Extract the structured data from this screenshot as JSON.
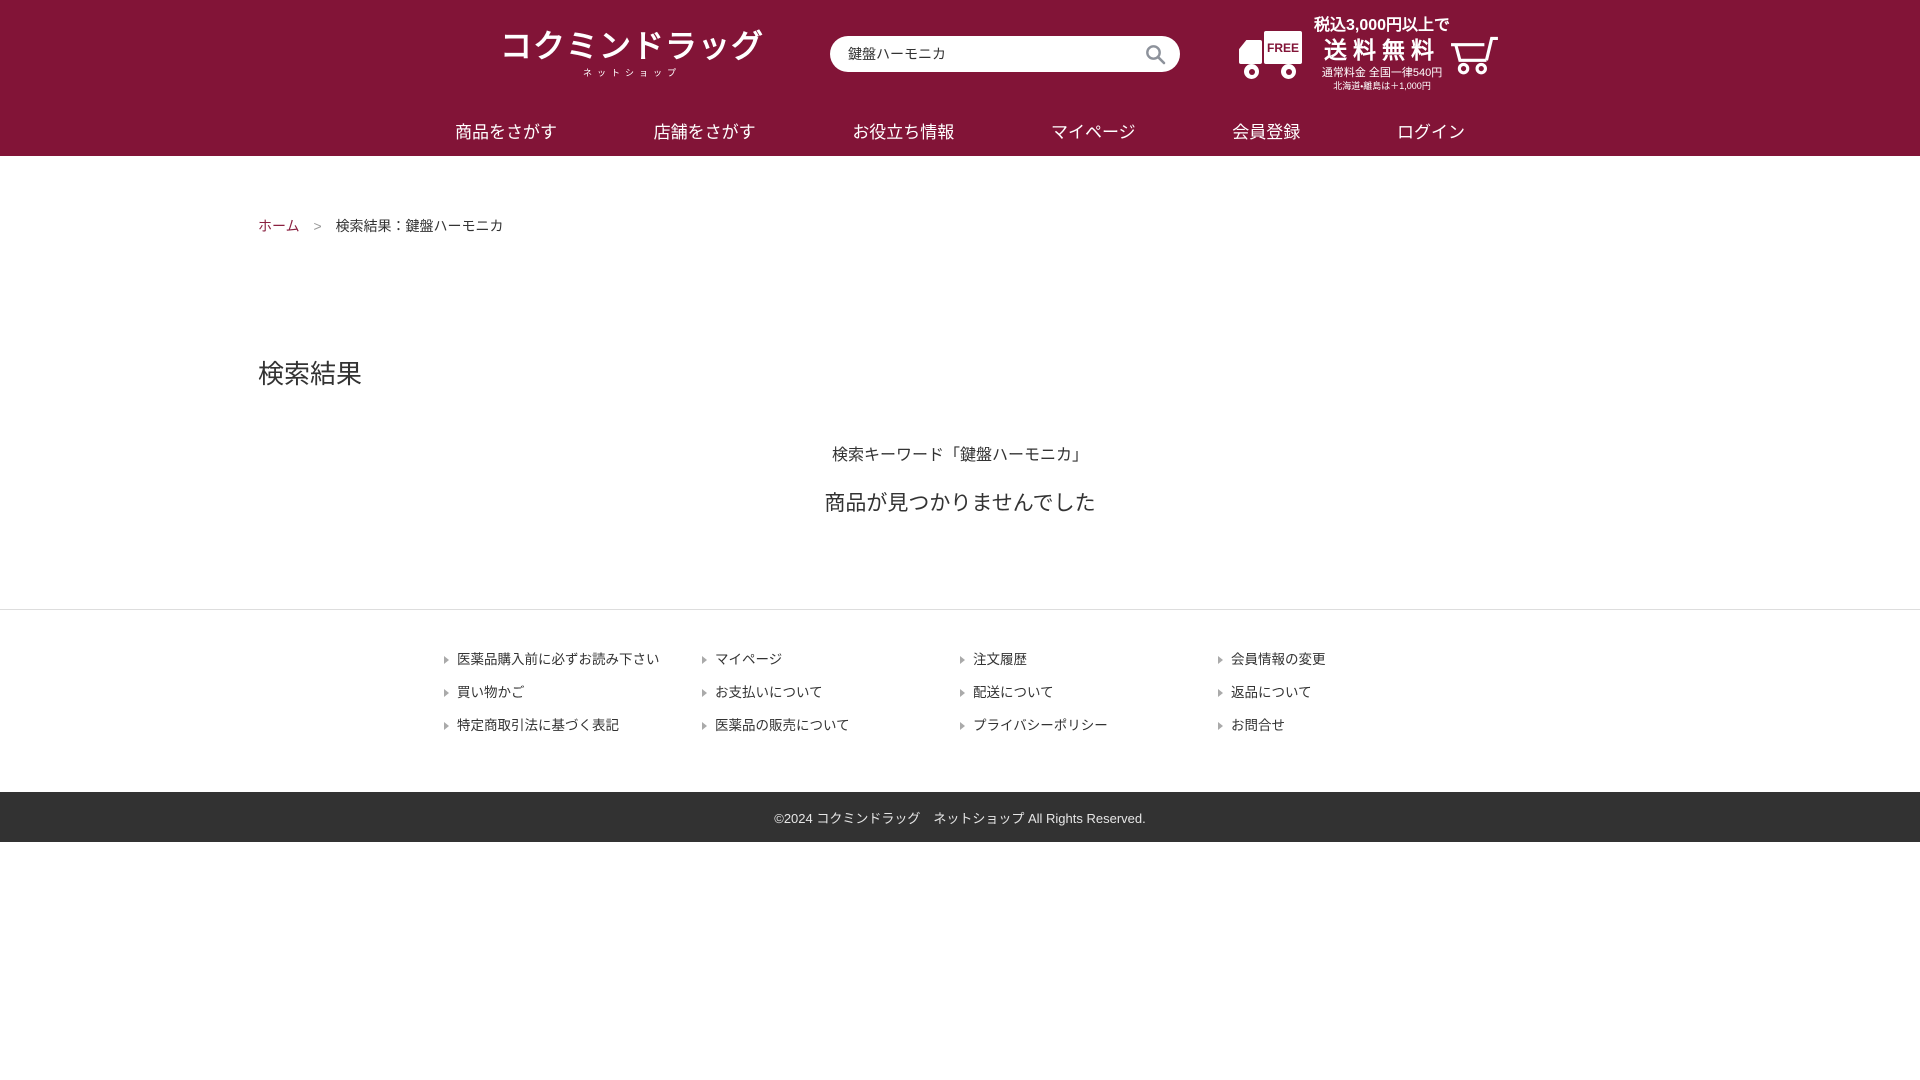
{
  "brand": {
    "logo_title": "コクミンドラッグ",
    "logo_subtitle": "ネットショップ"
  },
  "header": {
    "search": {
      "value": "鍵盤ハーモニカ"
    },
    "shipping": {
      "truck_badge": "FREE",
      "line1": "税込3,000円以上で",
      "line2": "送料無料",
      "line3": "通常料金 全国一律540円",
      "line4": "北海道・離島は＋1,000円"
    },
    "nav": [
      {
        "label": "商品をさがす"
      },
      {
        "label": "店舗をさがす"
      },
      {
        "label": "お役立ち情報"
      },
      {
        "label": "マイページ"
      },
      {
        "label": "会員登録"
      },
      {
        "label": "ログイン"
      }
    ]
  },
  "breadcrumb": {
    "home": "ホーム",
    "separator": ">",
    "current": "検索結果：鍵盤ハーモニカ"
  },
  "main": {
    "title": "検索結果",
    "keyword_line": "検索キーワード「鍵盤ハーモニカ」",
    "no_results": "商品が見つかりませんでした"
  },
  "footer": {
    "columns": [
      {
        "links": [
          "医薬品購入前に必ずお読み下さい",
          "買い物かご",
          "特定商取引法に基づく表記"
        ]
      },
      {
        "links": [
          "マイページ",
          "お支払いについて",
          "医薬品の販売について"
        ]
      },
      {
        "links": [
          "注文履歴",
          "配送について",
          "プライバシーポリシー"
        ]
      },
      {
        "links": [
          "会員情報の変更",
          "返品について",
          "お問合せ"
        ]
      }
    ],
    "copyright": "©2024 コクミンドラッグ　ネットショップ All Rights Reserved."
  },
  "colors": {
    "brand_maroon": "#821437",
    "copyright_bar": "#323232",
    "text_dark": "#333333"
  }
}
